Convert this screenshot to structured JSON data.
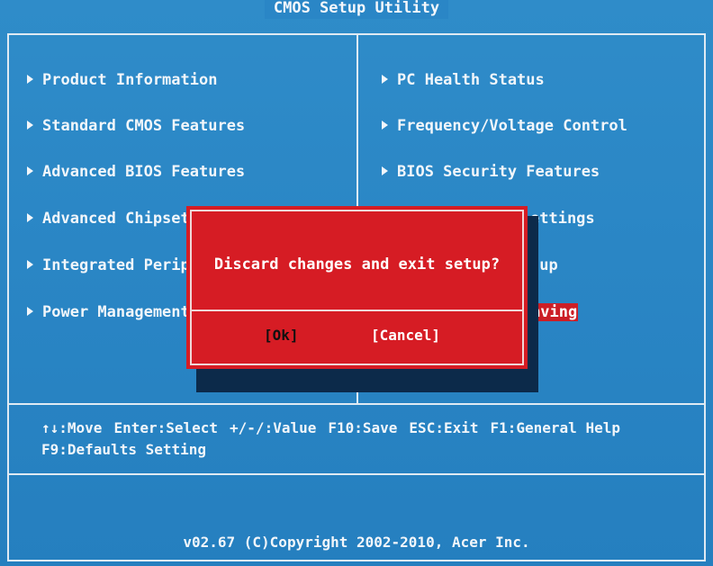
{
  "title": "CMOS Setup Utility",
  "left_menu": [
    {
      "label": "Product Information"
    },
    {
      "label": "Standard CMOS Features"
    },
    {
      "label": "Advanced BIOS Features"
    },
    {
      "label": "Advanced Chipset"
    },
    {
      "label": "Integrated Perip"
    },
    {
      "label": "Power Management"
    }
  ],
  "right_menu": [
    {
      "label": "PC Health Status"
    },
    {
      "label": "Frequency/Voltage Control"
    },
    {
      "label": "BIOS Security Features"
    },
    {
      "label": "ettings"
    },
    {
      "label": "tup"
    },
    {
      "label": "aving"
    }
  ],
  "keys": {
    "move": "↑↓:Move",
    "select": "Enter:Select",
    "value": "+/-/:Value",
    "save": "F10:Save",
    "exit": "ESC:Exit",
    "help": "F1:General Help",
    "defaults": "F9:Defaults Setting"
  },
  "footer": "v02.67 (C)Copyright 2002-2010, Acer Inc.",
  "dialog": {
    "message": "Discard changes and exit setup?",
    "ok_label": "[Ok]",
    "cancel_label": "[Cancel]"
  },
  "colors": {
    "background": "#2a86c6",
    "dialog": "#d61c24",
    "highlight": "#cc1e26",
    "text": "#f2f6fa"
  }
}
